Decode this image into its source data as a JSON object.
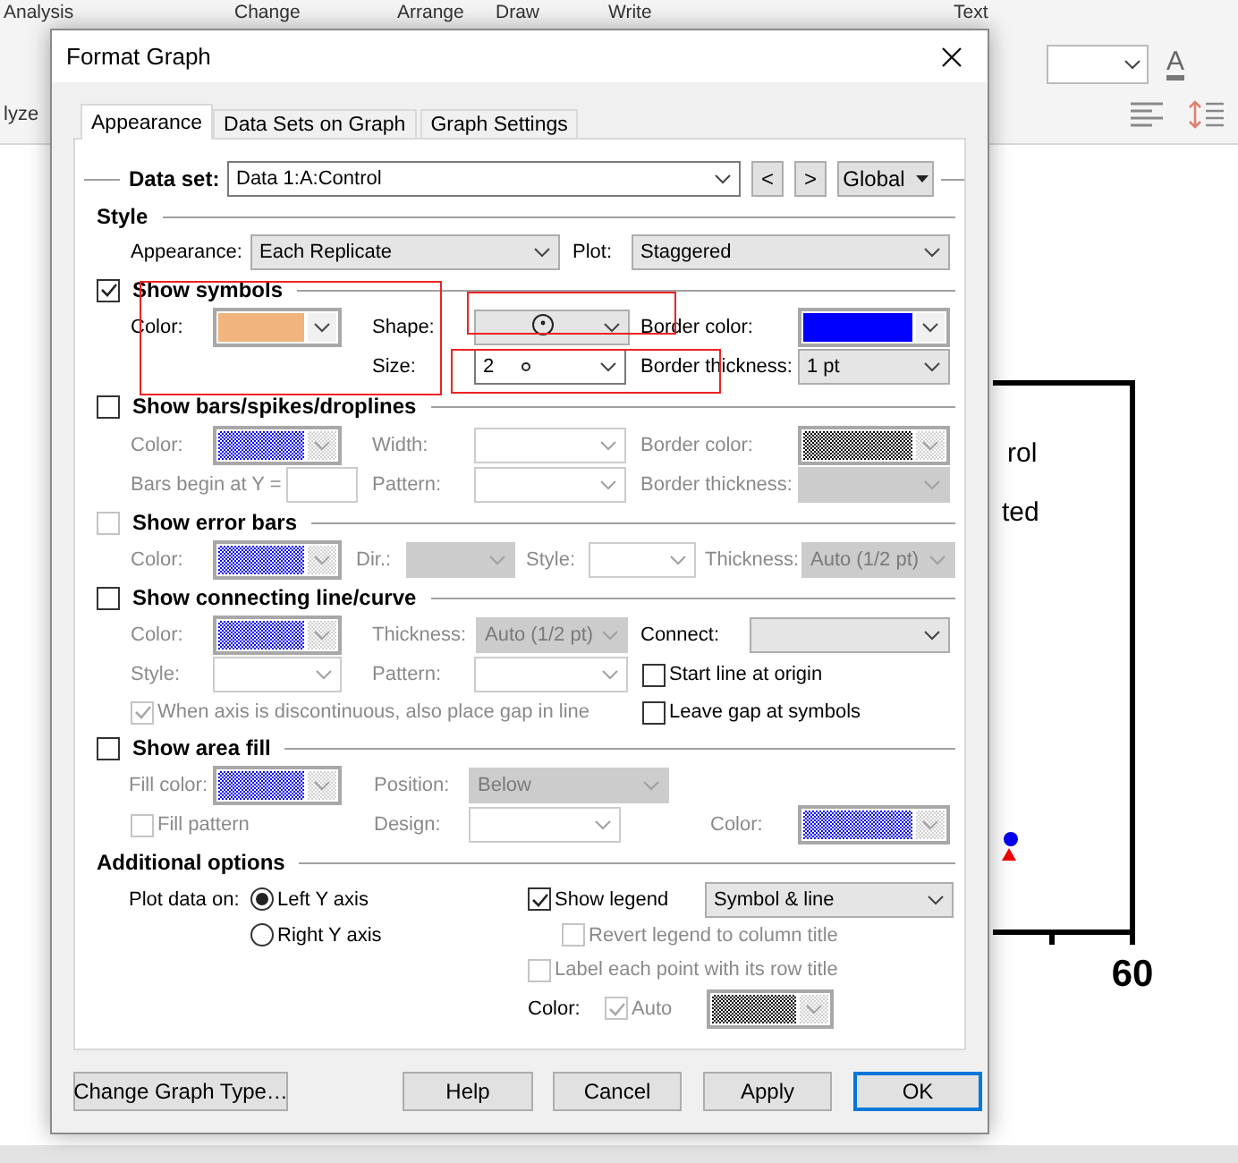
{
  "background": {
    "menu": [
      {
        "label": "Analysis"
      },
      {
        "label": "Change"
      },
      {
        "label": "Arrange"
      },
      {
        "label": "Draw"
      },
      {
        "label": "Write"
      },
      {
        "label": "Text"
      }
    ],
    "toolbar_label": "lyze",
    "font_color_icon": "A",
    "graph": {
      "legend": [
        "rol",
        "ted"
      ],
      "x_tick": "60"
    }
  },
  "window": {
    "title": "Format Graph"
  },
  "tabs": [
    {
      "label": "Appearance",
      "selected": true
    },
    {
      "label": "Data Sets on Graph",
      "selected": false
    },
    {
      "label": "Graph Settings",
      "selected": false
    }
  ],
  "data_set": {
    "label": "Data set:",
    "value": "Data 1:A:Control",
    "prev": "<",
    "next": ">",
    "scope": "Global"
  },
  "sections": [
    {
      "kind": "heading",
      "title": "Style",
      "rows": [
        [
          {
            "kind": "dropdown",
            "label": "Appearance:",
            "value": "Each Replicate",
            "disabled": false
          },
          {
            "kind": "dropdown",
            "label": "Plot:",
            "value": "Staggered",
            "disabled": false
          }
        ]
      ]
    },
    {
      "kind": "toggle",
      "title": "Show symbols",
      "checked": true,
      "disabled": false,
      "rows": [
        [
          {
            "kind": "swatch",
            "label": "Color:",
            "color": "#f0b47c",
            "dithered": false,
            "disabled": false
          },
          {
            "kind": "symbol-picker",
            "label": "Shape:",
            "disabled": false
          },
          {
            "kind": "swatch",
            "label": "Border color:",
            "color": "#0000ff",
            "dithered": false,
            "disabled": false
          }
        ],
        [
          "",
          {
            "kind": "size-picker",
            "label": "Size:",
            "value": "2",
            "disabled": false
          },
          {
            "kind": "dropdown",
            "label": "Border thickness:",
            "value": "1 pt",
            "disabled": false
          }
        ]
      ]
    },
    {
      "kind": "toggle",
      "title": "Show bars/spikes/droplines",
      "checked": false,
      "disabled": false,
      "rows": [
        [
          {
            "kind": "swatch",
            "label": "Color:",
            "color": "#0000ff",
            "dithered": true,
            "disabled": true
          },
          {
            "kind": "combo",
            "label": "Width:",
            "disabled": true
          },
          {
            "kind": "swatch",
            "label": "Border color:",
            "color": "#000000",
            "dithered": true,
            "disabled": true
          }
        ],
        [
          {
            "kind": "input",
            "label": "Bars begin at Y =",
            "disabled": true
          },
          {
            "kind": "combo",
            "label": "Pattern:",
            "disabled": true
          },
          {
            "kind": "dropdown",
            "label": "Border thickness:",
            "disabled": true
          }
        ]
      ]
    },
    {
      "kind": "toggle",
      "title": "Show error bars",
      "checked": false,
      "disabled": true,
      "rows": [
        [
          {
            "kind": "swatch",
            "label": "Color:",
            "color": "#0000ff",
            "dithered": true,
            "disabled": true
          },
          {
            "kind": "dropdown",
            "label": "Dir.:",
            "disabled": true
          },
          {
            "kind": "combo",
            "label": "Style:",
            "disabled": true
          },
          {
            "kind": "dropdown",
            "label": "Thickness:",
            "value": "Auto (1/2 pt)",
            "disabled": true
          }
        ]
      ]
    },
    {
      "kind": "toggle",
      "title": "Show connecting line/curve",
      "checked": false,
      "disabled": false,
      "rows": [
        [
          {
            "kind": "swatch",
            "label": "Color:",
            "color": "#0000ff",
            "dithered": true,
            "disabled": true
          },
          {
            "kind": "dropdown",
            "label": "Thickness:",
            "value": "Auto (1/2 pt)",
            "disabled": true
          },
          {
            "kind": "dropdown",
            "label": "Connect:",
            "disabled": false
          }
        ],
        [
          {
            "kind": "combo",
            "label": "Style:",
            "disabled": true
          },
          {
            "kind": "combo",
            "label": "Pattern:",
            "disabled": true
          },
          {
            "kind": "checkbox",
            "label": "Start line at origin",
            "checked": false,
            "disabled": false
          }
        ],
        [
          {
            "kind": "checkbox",
            "label": "When axis is discontinuous, also place gap in line",
            "checked": true,
            "disabled": true
          },
          "",
          {
            "kind": "checkbox",
            "label": "Leave gap at symbols",
            "checked": false,
            "disabled": false
          }
        ]
      ]
    },
    {
      "kind": "toggle",
      "title": "Show area fill",
      "checked": false,
      "disabled": false,
      "rows": [
        [
          {
            "kind": "swatch",
            "label": "Fill color:",
            "color": "#0000ff",
            "dithered": true,
            "disabled": true
          },
          {
            "kind": "dropdown",
            "label": "Position:",
            "value": "Below",
            "disabled": true
          }
        ],
        [
          {
            "kind": "checkbox",
            "label": "Fill pattern",
            "checked": false,
            "disabled": true
          },
          {
            "kind": "combo",
            "label": "Design:",
            "disabled": true
          },
          {
            "kind": "swatch",
            "label": "Color:",
            "color": "#0000ff",
            "dithered": true,
            "disabled": true
          }
        ]
      ]
    },
    {
      "kind": "heading",
      "title": "Additional options",
      "rows": [
        [
          {
            "kind": "text",
            "label": "Plot data on:"
          },
          {
            "kind": "radio",
            "label": "Left Y axis",
            "selected": true
          },
          {
            "kind": "checkbox",
            "label": "Show legend",
            "checked": true,
            "disabled": false
          },
          {
            "kind": "dropdown",
            "value": "Symbol & line",
            "disabled": false
          }
        ],
        [
          {
            "kind": "radio",
            "label": "Right  Y axis",
            "selected": false
          },
          {
            "kind": "checkbox",
            "label": "Revert legend to column title",
            "checked": false,
            "disabled": true
          }
        ],
        [
          {
            "kind": "checkbox",
            "label": "Label each point with its row title",
            "checked": false,
            "disabled": true
          }
        ],
        [
          {
            "kind": "text",
            "label": "Color:"
          },
          {
            "kind": "checkbox",
            "label": "Auto",
            "checked": true,
            "disabled": true
          },
          {
            "kind": "swatch",
            "color": "#000000",
            "dithered": true,
            "disabled": true
          }
        ]
      ]
    }
  ],
  "buttons": [
    {
      "label": "Change Graph Type…",
      "default": false
    },
    {
      "label": "Help",
      "default": false
    },
    {
      "label": "Cancel",
      "default": false
    },
    {
      "label": "Apply",
      "default": false
    },
    {
      "label": "OK",
      "default": true
    }
  ]
}
